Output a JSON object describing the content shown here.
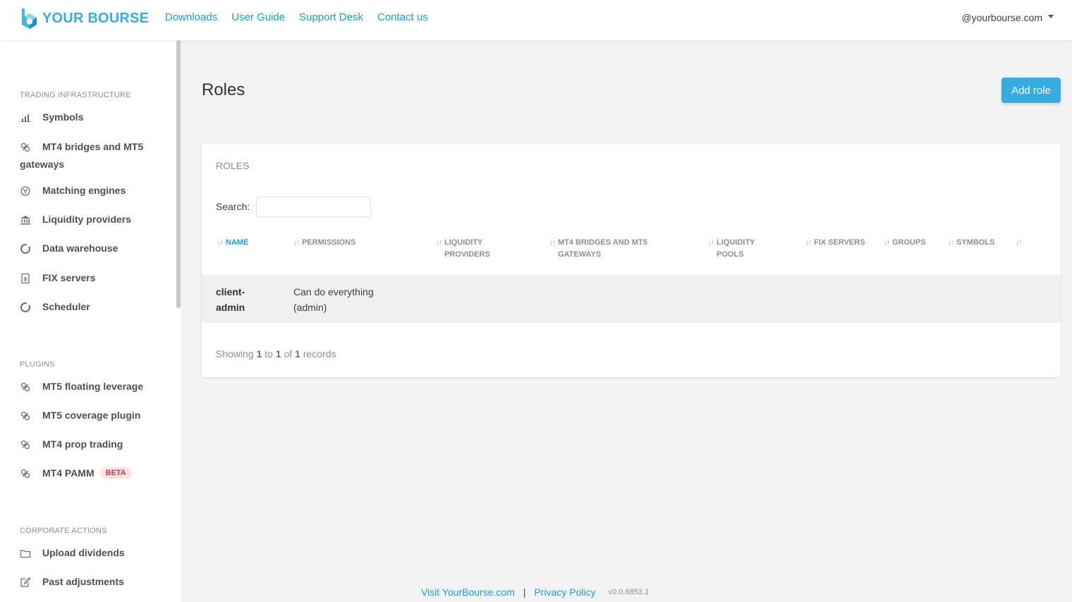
{
  "brand": {
    "name": "YOUR BOURSE"
  },
  "topnav": [
    {
      "label": "Downloads"
    },
    {
      "label": "User Guide"
    },
    {
      "label": "Support Desk"
    },
    {
      "label": "Contact us"
    }
  ],
  "user": {
    "email": "@yourbourse.com"
  },
  "sidebar": {
    "sections": [
      {
        "title": "TRADING INFRASTRUCTURE"
      },
      {
        "title": "PLUGINS"
      },
      {
        "title": "CORPORATE ACTIONS"
      }
    ],
    "items": [
      {
        "label": "Symbols",
        "icon": "bar-chart-icon"
      },
      {
        "label": "MT4 bridges and MT5 gateways",
        "icon": "link-icon"
      },
      {
        "label": "Matching engines",
        "icon": "matching-icon"
      },
      {
        "label": "Liquidity providers",
        "icon": "bank-icon"
      },
      {
        "label": "Data warehouse",
        "icon": "circle-icon"
      },
      {
        "label": "FIX servers",
        "icon": "document-dollar-icon"
      },
      {
        "label": "Scheduler",
        "icon": "circle-icon"
      },
      {
        "label": "MT5 floating leverage",
        "icon": "link-icon"
      },
      {
        "label": "MT5 coverage plugin",
        "icon": "link-icon"
      },
      {
        "label": "MT4 prop trading",
        "icon": "link-icon"
      },
      {
        "label": "MT4 PAMM",
        "icon": "link-icon",
        "badge": "BETA"
      },
      {
        "label": "Upload dividends",
        "icon": "folder-icon"
      },
      {
        "label": "Past adjustments",
        "icon": "edit-icon"
      }
    ]
  },
  "page": {
    "title": "Roles",
    "add_button": "Add role"
  },
  "table": {
    "card_title": "ROLES",
    "search_label": "Search:",
    "search_value": "",
    "columns": [
      {
        "label": "NAME"
      },
      {
        "label": "PERMISSIONS"
      },
      {
        "label": "LIQUIDITY PROVIDERS"
      },
      {
        "label": "MT4 BRIDGES AND MT5 GATEWAYS"
      },
      {
        "label": "LIQUIDITY POOLS"
      },
      {
        "label": "FIX SERVERS"
      },
      {
        "label": "GROUPS"
      },
      {
        "label": "SYMBOLS"
      },
      {
        "label": ""
      }
    ],
    "rows": [
      {
        "name": "client-admin",
        "permissions": "Can do everything (admin)"
      }
    ],
    "info": {
      "prefix": "Showing",
      "from": "1",
      "to_word": "to",
      "to": "1",
      "of_word": "of",
      "total": "1",
      "suffix": "records"
    }
  },
  "footer": {
    "visit": "Visit YourBourse.com",
    "separator": "|",
    "privacy": "Privacy Policy",
    "version": "v0.0.6853.1"
  },
  "colors": {
    "accent": "#36ace2",
    "link": "#1d9bd6",
    "beta_bg": "#fde3e6",
    "beta_text": "#e0314b"
  }
}
